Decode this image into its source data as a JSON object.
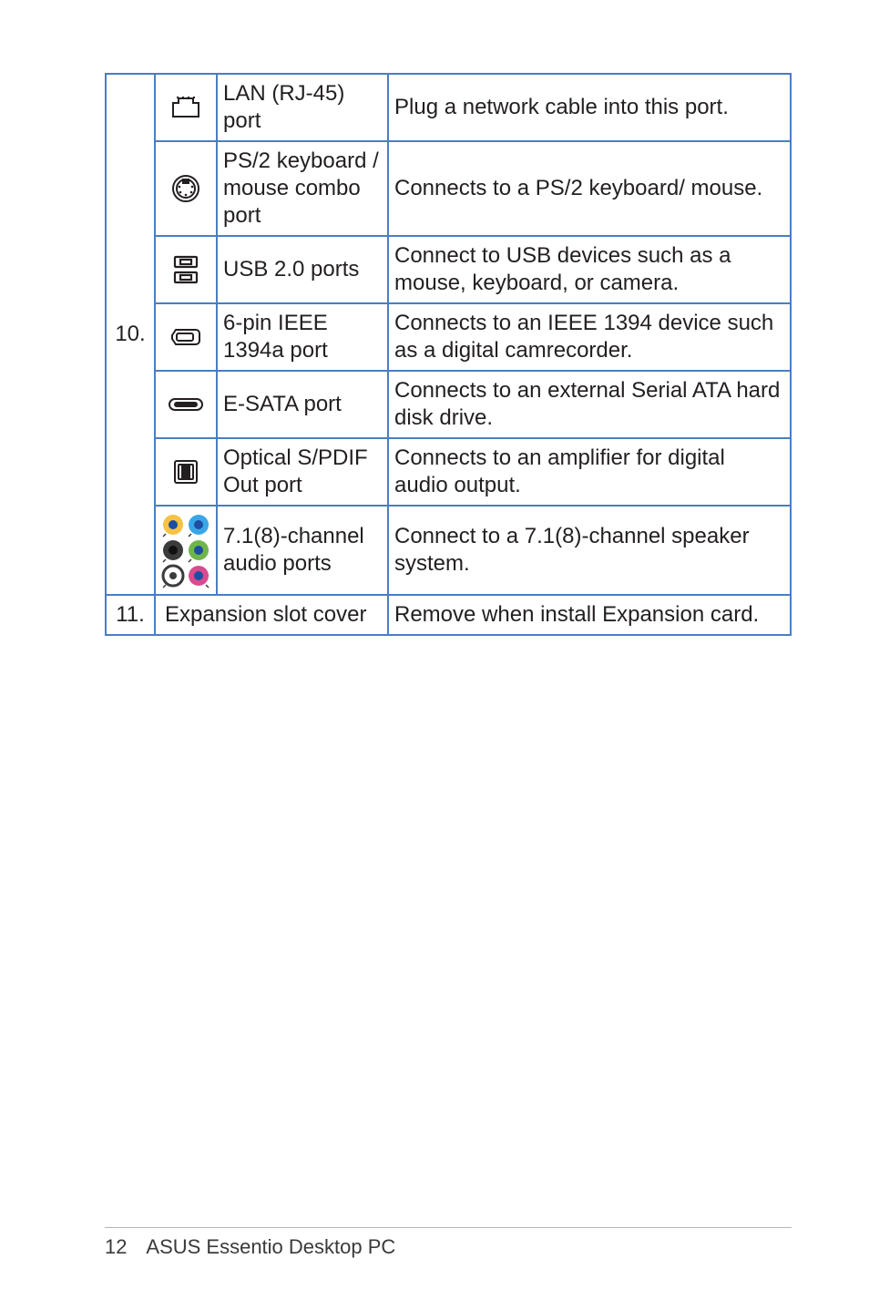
{
  "table": {
    "group10": {
      "index": "10.",
      "rows": [
        {
          "name": "LAN (RJ-45) port",
          "desc": "Plug a network cable into this port."
        },
        {
          "name": "PS/2 keyboard / mouse combo port",
          "desc": "Connects to a PS/2 keyboard/ mouse."
        },
        {
          "name": "USB 2.0 ports",
          "desc": "Connect to USB devices such as a mouse, keyboard, or camera."
        },
        {
          "name": "6-pin IEEE 1394a port",
          "desc": "Connects to an IEEE 1394 device such as a digital camrecorder."
        },
        {
          "name": "E-SATA port",
          "desc": "Connects to an external Serial ATA hard disk drive."
        },
        {
          "name": "Optical S/PDIF Out port",
          "desc": "Connects to an amplifier for digital audio output."
        },
        {
          "name": "7.1(8)-channel audio ports",
          "desc": "Connect to a 7.1(8)-channel speaker system."
        }
      ]
    },
    "row11": {
      "index": "11.",
      "name": "Expansion slot cover",
      "desc": "Remove when install Expansion card."
    }
  },
  "footer": {
    "page": "12",
    "title": "ASUS Essentio Desktop PC"
  }
}
